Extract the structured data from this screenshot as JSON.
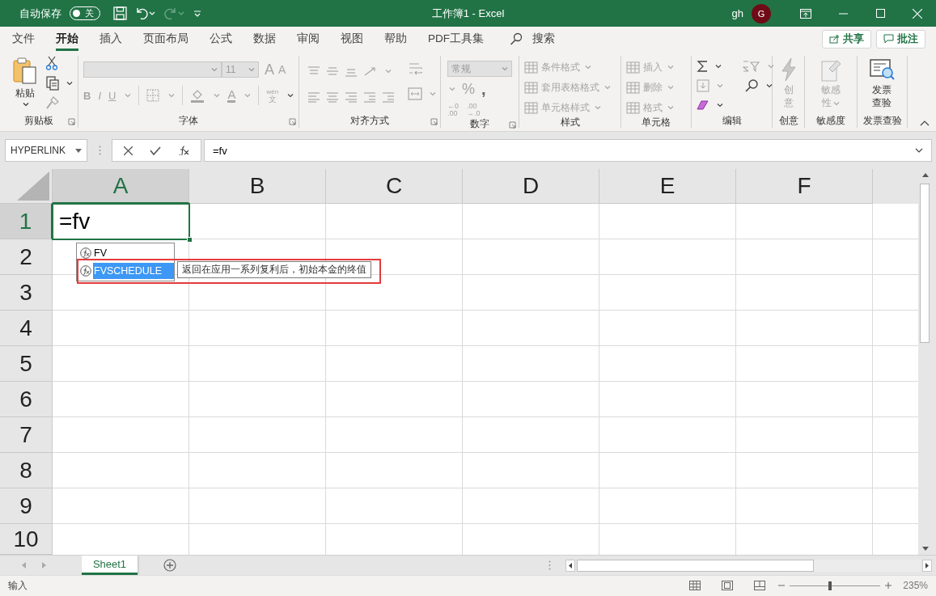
{
  "title_bar": {
    "autosave_label": "自动保存",
    "autosave": {
      "on": false,
      "label": "关"
    },
    "title": "工作簿1  -  Excel",
    "user": "gh",
    "avatar": "G"
  },
  "quick_access": [
    {
      "kind": "save",
      "disabled": false
    },
    {
      "kind": "undo",
      "disabled": false
    },
    {
      "kind": "redo",
      "disabled": true
    },
    {
      "kind": "customize",
      "disabled": false
    }
  ],
  "menu_tabs": [
    {
      "label": "文件",
      "selected": false
    },
    {
      "label": "开始",
      "selected": true
    },
    {
      "label": "插入",
      "selected": false
    },
    {
      "label": "页面布局",
      "selected": false
    },
    {
      "label": "公式",
      "selected": false
    },
    {
      "label": "数据",
      "selected": false
    },
    {
      "label": "审阅",
      "selected": false
    },
    {
      "label": "视图",
      "selected": false
    },
    {
      "label": "帮助",
      "selected": false
    },
    {
      "label": "PDF工具集",
      "selected": false
    }
  ],
  "search": {
    "label": "搜索"
  },
  "share_button": "共享",
  "comments_button": "批注",
  "ribbon": {
    "clipboard": {
      "label": "剪贴板",
      "launcher": true,
      "paste": {
        "label": "粘贴",
        "disabled": false
      }
    },
    "font": {
      "label": "字体",
      "launcher": true,
      "font_box": {
        "disabled": true,
        "size": "11"
      },
      "grow": "A",
      "shrink": "A",
      "bold": "B",
      "italic": "I",
      "underline": "U",
      "font_color": "A",
      "phonetic": {
        "pinyin": "wén",
        "hanzi": "文"
      }
    },
    "alignment": {
      "label": "对齐方式",
      "launcher": true
    },
    "number": {
      "label": "数字",
      "launcher": true,
      "format_box": {
        "disabled": true,
        "value": "常规"
      },
      "percent": "%",
      "comma": ",",
      "increase_decimal": {
        "top": "←0",
        "bottom": ".00"
      },
      "decrease_decimal": {
        "top": ".00",
        "bottom": "→.0"
      }
    },
    "styles": {
      "label": "样式",
      "launcher": false,
      "items": [
        {
          "label": "条件格式",
          "disabled": true
        },
        {
          "label": "套用表格格式",
          "disabled": true
        },
        {
          "label": "单元格样式",
          "disabled": true
        }
      ]
    },
    "cells": {
      "label": "单元格",
      "launcher": false,
      "items": [
        {
          "label": "插入",
          "disabled": true
        },
        {
          "label": "删除",
          "disabled": true
        },
        {
          "label": "格式",
          "disabled": true
        }
      ]
    },
    "editing": {
      "label": "编辑",
      "launcher": false
    },
    "ideas": {
      "label": "创意",
      "launcher": false,
      "button": {
        "label": "创意",
        "disabled": true
      }
    },
    "sensitivity": {
      "label": "敏感度",
      "launcher": false,
      "button": {
        "label": "敏感性",
        "disabled": true
      }
    },
    "invoice": {
      "label": "发票查验",
      "launcher": false,
      "button": {
        "label": "发票查验",
        "disabled": false
      }
    }
  },
  "formula_bar": {
    "name_box": "HYPERLINK",
    "formula": "=fv"
  },
  "sheet": {
    "columns": [
      {
        "label": "A",
        "selected": true
      },
      {
        "label": "B",
        "selected": false
      },
      {
        "label": "C",
        "selected": false
      },
      {
        "label": "D",
        "selected": false
      },
      {
        "label": "E",
        "selected": false
      },
      {
        "label": "F",
        "selected": false
      }
    ],
    "rows": [
      {
        "label": "1",
        "selected": true
      },
      {
        "label": "2",
        "selected": false
      },
      {
        "label": "3",
        "selected": false
      },
      {
        "label": "4",
        "selected": false
      },
      {
        "label": "5",
        "selected": false
      },
      {
        "label": "6",
        "selected": false
      },
      {
        "label": "7",
        "selected": false
      },
      {
        "label": "8",
        "selected": false
      },
      {
        "label": "9",
        "selected": false
      },
      {
        "label": "10",
        "selected": false
      }
    ],
    "active_cell": {
      "value": "=fv"
    },
    "autocomplete": [
      {
        "label": "FV",
        "selected": false
      },
      {
        "label": "FVSCHEDULE",
        "selected": true
      }
    ],
    "tooltip": "返回在应用一系列复利后，初始本金的终值"
  },
  "sheet_tabs": [
    {
      "label": "Sheet1",
      "selected": true
    }
  ],
  "status_bar": {
    "mode": "输入",
    "zoom": {
      "level": 0.44,
      "label": "235%"
    }
  }
}
